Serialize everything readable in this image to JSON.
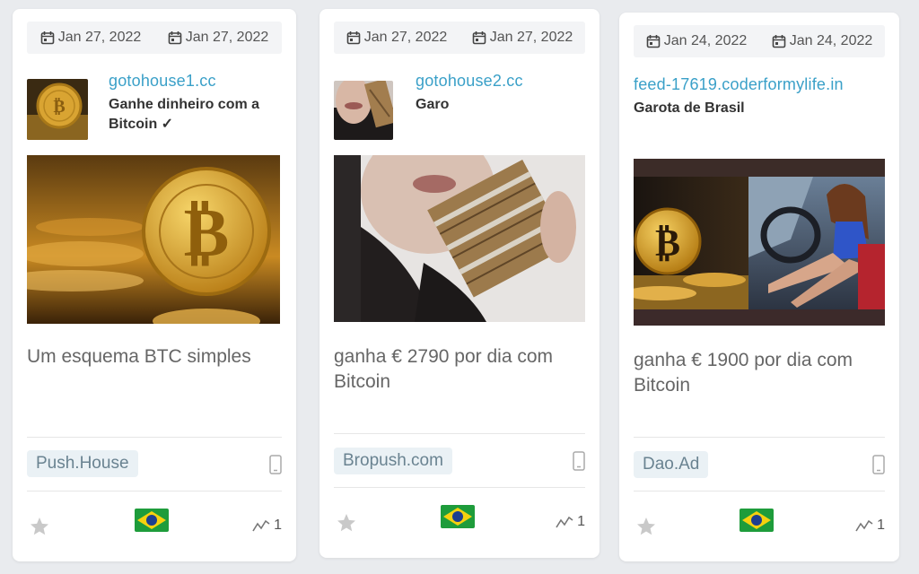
{
  "cards": [
    {
      "date_first": "Jan 27, 2022",
      "date_last": "Jan 27, 2022",
      "domain": "gotohouse1.cc",
      "title": "Ganhe dinheiro com a Bitcoin ✓",
      "text": "Um esquema BTC simples",
      "network": "Push.House",
      "country": "Brazil",
      "count": "1"
    },
    {
      "date_first": "Jan 27, 2022",
      "date_last": "Jan 27, 2022",
      "domain": "gotohouse2.cc",
      "title": "Garo",
      "text": "ganha € 2790 por dia com Bitcoin",
      "network": "Bropush.com",
      "country": "Brazil",
      "count": "1"
    },
    {
      "date_first": "Jan 24, 2022",
      "date_last": "Jan 24, 2022",
      "domain": "feed-17619.coderformylife.in",
      "title": "Garota de Brasil",
      "text": "ganha € 1900 por dia com Bitcoin",
      "network": "Dao.Ad",
      "country": "Brazil",
      "count": "1"
    }
  ],
  "icons": {
    "calendar": "calendar-icon",
    "device": "mobile-icon",
    "favorite": "star-icon",
    "trend": "trend-icon",
    "flag": "brazil-flag-icon"
  },
  "colors": {
    "link": "#3aa0c8",
    "badge_bg": "#eaf1f5",
    "badge_text": "#6a8391",
    "star": "#c9c9c9"
  }
}
